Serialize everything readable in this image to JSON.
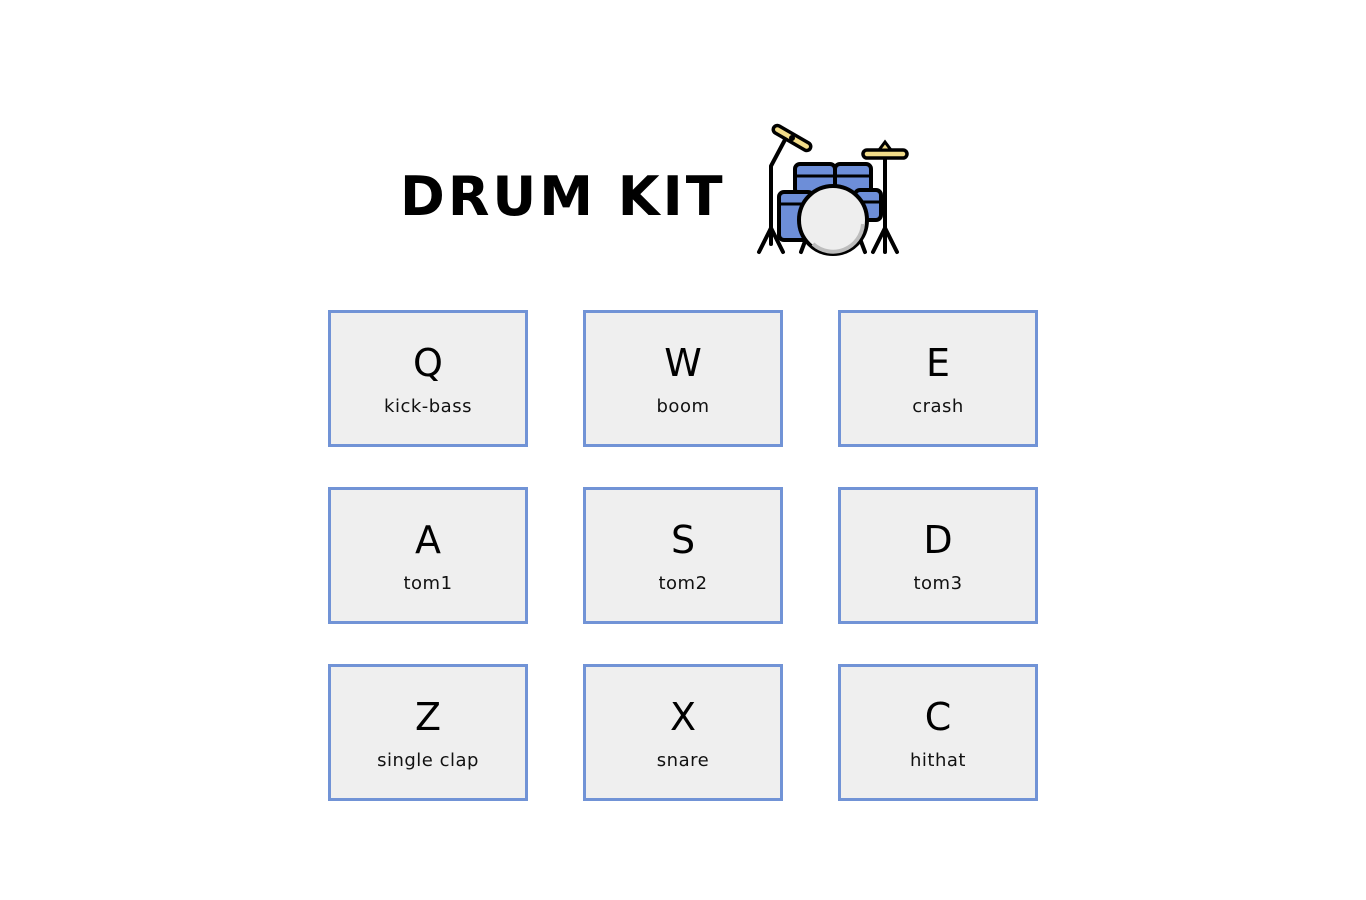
{
  "header": {
    "title": "DRUM KIT",
    "icon": "drum-kit-icon"
  },
  "colors": {
    "pad_border": "#7193d6",
    "pad_background": "#efefef",
    "drum_blue": "#6d8ed8",
    "cymbal_yellow": "#f3dd8a"
  },
  "pads": [
    {
      "key": "Q",
      "sound": "kick-bass"
    },
    {
      "key": "W",
      "sound": "boom"
    },
    {
      "key": "E",
      "sound": "crash"
    },
    {
      "key": "A",
      "sound": "tom1"
    },
    {
      "key": "S",
      "sound": "tom2"
    },
    {
      "key": "D",
      "sound": "tom3"
    },
    {
      "key": "Z",
      "sound": "single clap"
    },
    {
      "key": "X",
      "sound": "snare"
    },
    {
      "key": "C",
      "sound": "hithat"
    }
  ]
}
